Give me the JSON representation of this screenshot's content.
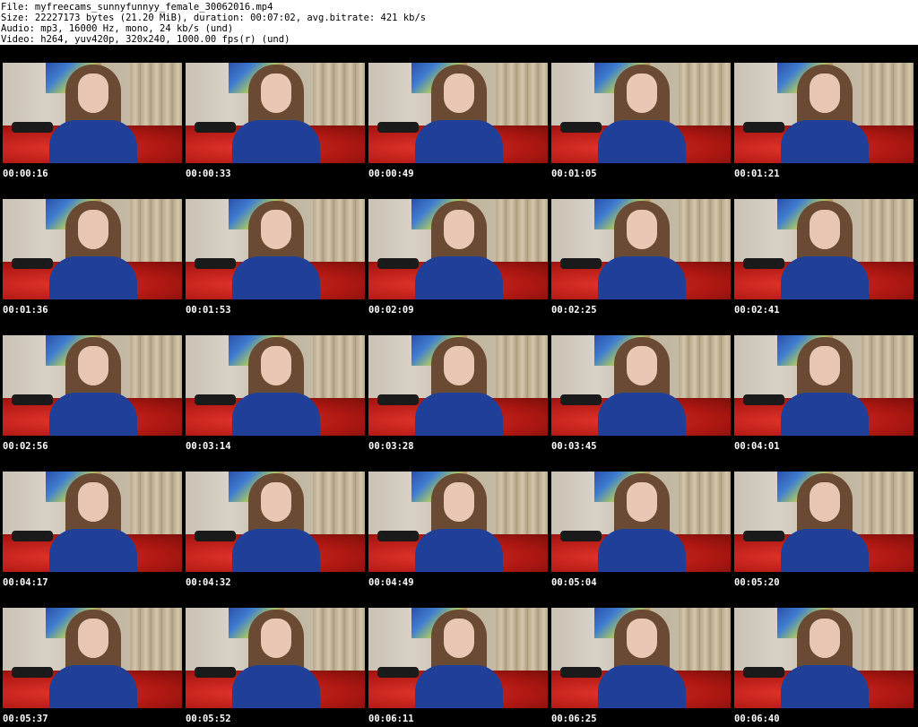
{
  "header": {
    "file_line": "File: myfreecams_sunnyfunnyy_female_30062016.mp4",
    "size_line": "Size: 22227173 bytes (21.20 MiB), duration: 00:07:02, avg.bitrate: 421 kb/s",
    "audio_line": "Audio: mp3, 16000 Hz, mono, 24 kb/s (und)",
    "video_line": "Video: h264, yuv420p, 320x240, 1000.00 fps(r) (und)"
  },
  "thumbnails": [
    {
      "time": "00:00:16"
    },
    {
      "time": "00:00:33"
    },
    {
      "time": "00:00:49"
    },
    {
      "time": "00:01:05"
    },
    {
      "time": "00:01:21"
    },
    {
      "time": "00:01:36"
    },
    {
      "time": "00:01:53"
    },
    {
      "time": "00:02:09"
    },
    {
      "time": "00:02:25"
    },
    {
      "time": "00:02:41"
    },
    {
      "time": "00:02:56"
    },
    {
      "time": "00:03:14"
    },
    {
      "time": "00:03:28"
    },
    {
      "time": "00:03:45"
    },
    {
      "time": "00:04:01"
    },
    {
      "time": "00:04:17"
    },
    {
      "time": "00:04:32"
    },
    {
      "time": "00:04:49"
    },
    {
      "time": "00:05:04"
    },
    {
      "time": "00:05:20"
    },
    {
      "time": "00:05:37"
    },
    {
      "time": "00:05:52"
    },
    {
      "time": "00:06:11"
    },
    {
      "time": "00:06:25"
    },
    {
      "time": "00:06:40"
    }
  ],
  "colors": {
    "sheet_background": "#000000",
    "timestamp_text": "#ffffff",
    "header_text": "#000000"
  }
}
